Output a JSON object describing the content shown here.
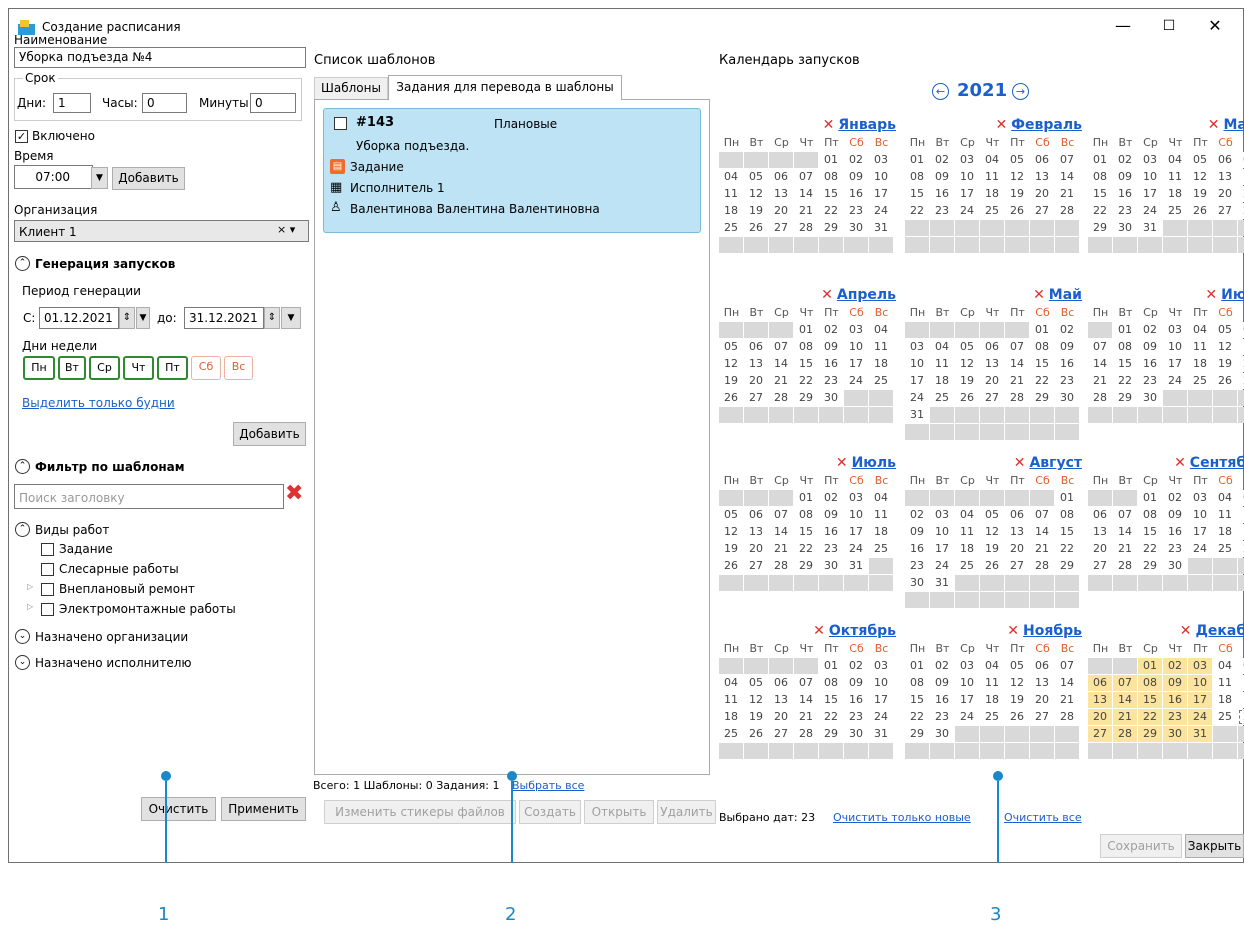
{
  "window": {
    "title": "Создание расписания",
    "min": "—",
    "max": "☐",
    "close": "✕"
  },
  "left": {
    "name_label": "Наименование",
    "name_value": "Уборка подъезда №4",
    "term_label": "Срок",
    "days_label": "Дни:",
    "days_value": "1",
    "hours_label": "Часы:",
    "hours_value": "0",
    "minutes_label": "Минуты:",
    "minutes_value": "0",
    "enabled_label": "Включено",
    "time_label": "Время",
    "time_value": "07:00",
    "add_time_btn": "Добавить",
    "org_label": "Организация",
    "org_value": "Клиент 1",
    "gen_header": "Генерация запусков",
    "period_label": "Период генерации",
    "from_label": "С:",
    "from_value": "01.12.2021",
    "to_label": "до:",
    "to_value": "31.12.2021",
    "weekdays_label": "Дни недели",
    "weekdays": [
      "Пн",
      "Вт",
      "Ср",
      "Чт",
      "Пт",
      "Сб",
      "Вс"
    ],
    "weekdays_only_link": "Выделить только будни",
    "add_btn": "Добавить",
    "filter_header": "Фильтр по шаблонам",
    "search_placeholder": "Поиск заголовку",
    "work_types_header": "Виды работ",
    "work_types": [
      "Задание",
      "Слесарные работы",
      "Внеплановый ремонт",
      "Электромонтажные работы"
    ],
    "assigned_org": "Назначено организации",
    "assigned_exec": "Назначено исполнителю",
    "clear_btn": "Очистить",
    "apply_btn": "Применить"
  },
  "middle": {
    "title": "Список шаблонов",
    "tabs": [
      "Шаблоны",
      "Задания для перевода в шаблоны"
    ],
    "card": {
      "id": "#143",
      "type": "Плановые",
      "desc": "Уборка подъезда.",
      "task": "Задание",
      "executor": "Исполнитель 1",
      "person": "Валентинова Валентина Валентиновна"
    },
    "status": "Всего: 1 Шаблоны: 0 Задания: 1",
    "select_all": "Выбрать все",
    "btn_stickers": "Изменить стикеры файлов",
    "btn_create": "Создать",
    "btn_open": "Открыть",
    "btn_delete": "Удалить"
  },
  "calendar": {
    "title": "Календарь запусков",
    "year": "2021",
    "dow": [
      "Пн",
      "Вт",
      "Ср",
      "Чт",
      "Пт",
      "Сб",
      "Вс"
    ],
    "months": [
      {
        "name": "Январь",
        "offset": 4,
        "days": 31
      },
      {
        "name": "Февраль",
        "offset": 0,
        "days": 28
      },
      {
        "name": "Март",
        "offset": 0,
        "days": 31
      },
      {
        "name": "Апрель",
        "offset": 3,
        "days": 30
      },
      {
        "name": "Май",
        "offset": 5,
        "days": 31
      },
      {
        "name": "Июнь",
        "offset": 1,
        "days": 30
      },
      {
        "name": "Июль",
        "offset": 3,
        "days": 31
      },
      {
        "name": "Август",
        "offset": 6,
        "days": 31
      },
      {
        "name": "Сентябрь",
        "offset": 2,
        "days": 30
      },
      {
        "name": "Октябрь",
        "offset": 4,
        "days": 31
      },
      {
        "name": "Ноябрь",
        "offset": 0,
        "days": 30
      },
      {
        "name": "Декабрь",
        "offset": 2,
        "days": 31
      }
    ],
    "selected_december": [
      1,
      2,
      3,
      6,
      7,
      8,
      9,
      10,
      13,
      14,
      15,
      16,
      17,
      20,
      21,
      22,
      23,
      24,
      27,
      28,
      29,
      30,
      31
    ],
    "selected_count_label": "Выбрано дат: 23",
    "clear_new_link": "Очистить только новые",
    "clear_all_link": "Очистить все",
    "save_btn": "Сохранить",
    "close_btn": "Закрыть"
  },
  "annotations": [
    "1",
    "2",
    "3"
  ],
  "colors": {
    "accent": "#1a87c8",
    "link": "#1a5fcc",
    "selected": "#fbe49e",
    "card": "#bde3f5"
  }
}
